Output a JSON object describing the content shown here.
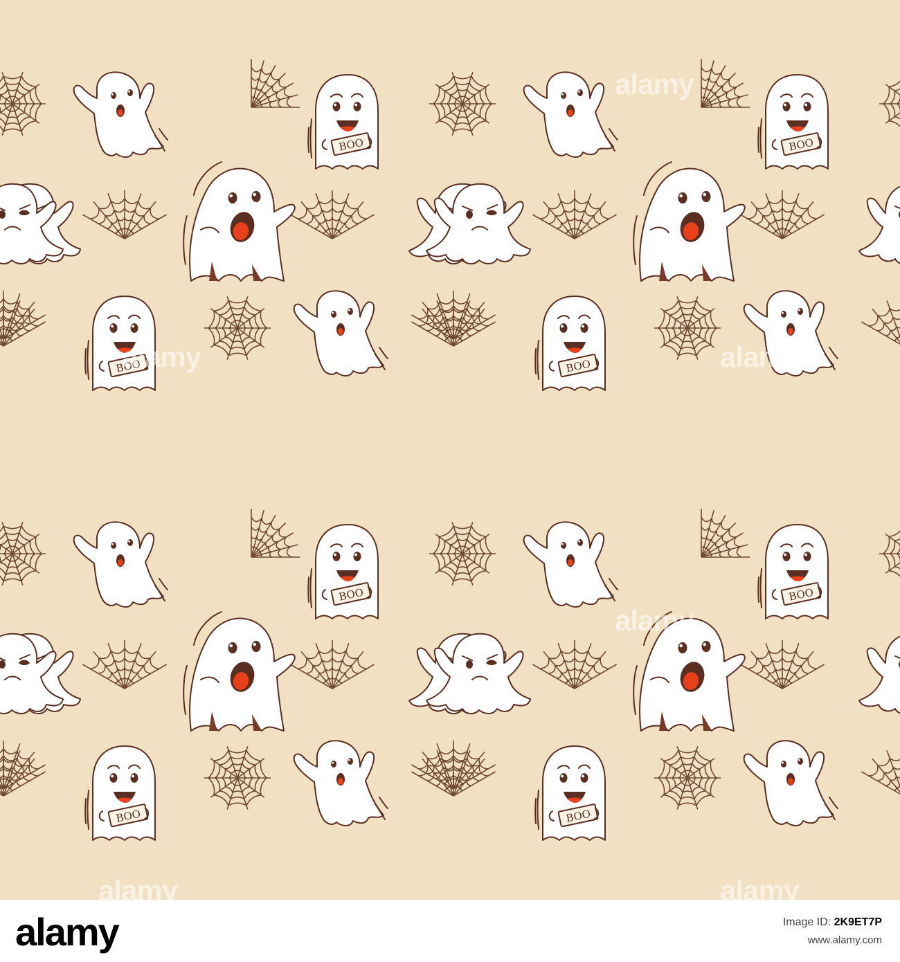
{
  "image": {
    "background_color": "#f1e0c2",
    "ghost_fill": "#ffffff",
    "outline_color": "#5a2f22",
    "mouth_color": "#e8401a",
    "web_color": "#6e4a30",
    "sign_text": "BOO",
    "watermark_text": "alamy"
  },
  "footer": {
    "logo": "alamy",
    "image_id_label": "Image ID:",
    "image_id": "2K9ET7P",
    "url": "www.alamy.com"
  }
}
